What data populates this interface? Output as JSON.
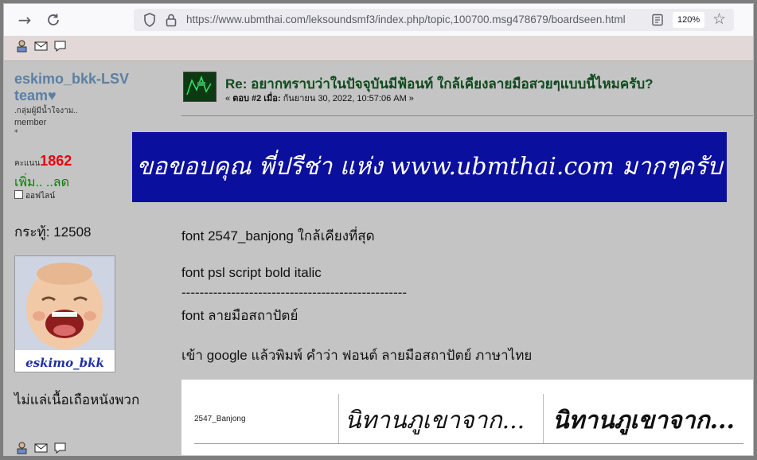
{
  "browser": {
    "url": "https://www.ubmthai.com/leksoundsmf3/index.php/topic,100700.msg478679/boardseen.html",
    "zoom": "120%",
    "icons": [
      "forward-icon",
      "reload-icon",
      "shield-icon",
      "lock-icon",
      "reader-view-icon",
      "bookmark-star-icon"
    ]
  },
  "user": {
    "name": "eskimo_bkk-LSV team♥",
    "group": ".กลุ่มผู้มีน้ำใจงาม..",
    "rank": "member",
    "stars": "*",
    "karma_label": "คะแนน",
    "karma_value": "1862",
    "karma_actions": "เพิ่ม.. ..ลด",
    "status": "ออฟไลน์",
    "posts": "กระทู้: 12508",
    "avatar_caption": "eskimo_bkk",
    "signature": "ไม่แล่เนื้อเถือหนังพวก"
  },
  "post": {
    "title": "Re: อยากทราบว่าในปัจจุบันมีฟ้อนท์ ใกล้เคียงลายมือสวยๆแบบนี้ไหมครับ?",
    "meta_prefix": "« ",
    "meta_reply": "ตอบ #2",
    "meta_on": " เมื่อ:",
    "meta_date": " กันยายน 30, 2022, 10:57:06 AM »",
    "banner_text": "ขอขอบคุณ พี่ปรีช่า แห่ง www.ubmthai.com มากๆครับ",
    "lines": [
      "font 2547_banjong ใกล้เคียงที่สุด",
      "font  psl script bold italic",
      "--------------------------------------------------",
      "font ลายมือสถาปัตย์",
      "เข้า google แล้วพิมพ์ คำว่า ฟอนต์ ลายมือสถาปัตย์ ภาษาไทย"
    ],
    "sample_label": "2547_Banjong",
    "sample_text_1": "นิทานภูเขาจาก...",
    "sample_text_2": "นิทานภูเขาจาก..."
  }
}
